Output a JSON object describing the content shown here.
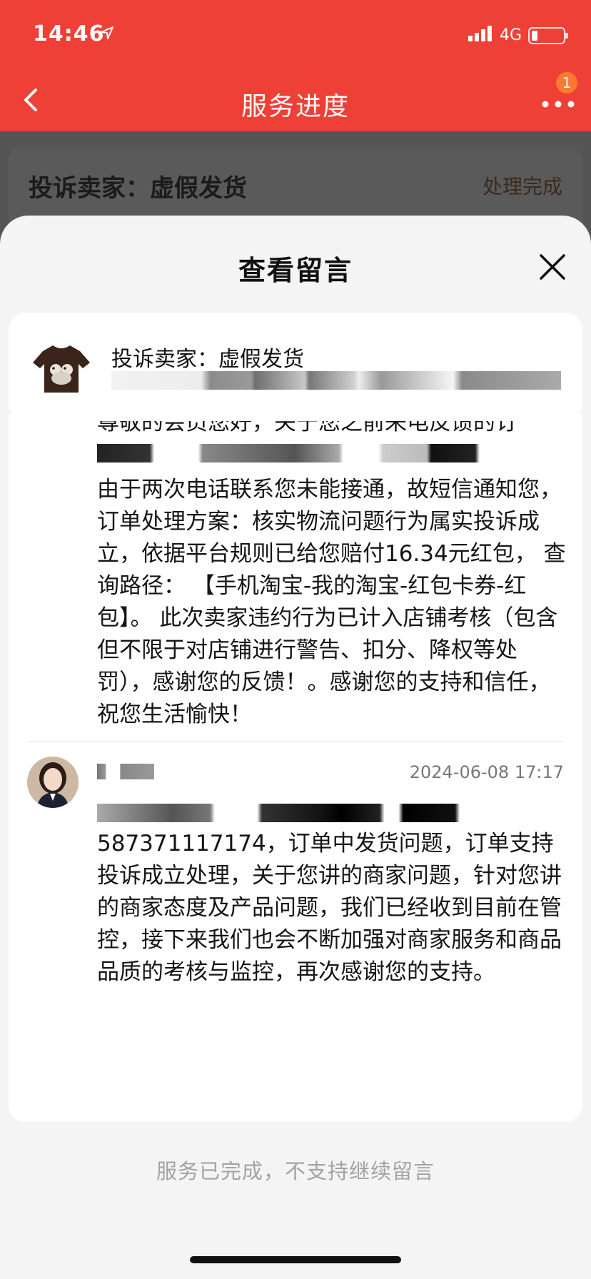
{
  "status_bar": {
    "time": "14:46",
    "network": "4G",
    "battery_level": 0.2
  },
  "nav": {
    "title": "服务进度",
    "badge_count": "1"
  },
  "background": {
    "complaint_title": "投诉卖家：虚假发货",
    "status": "处理完成"
  },
  "sheet": {
    "title": "查看留言",
    "product": {
      "title": "投诉卖家：虚假发货"
    },
    "messages": [
      {
        "partial_first_line": "尊敬的会员您好，关于您之前来电反馈的订",
        "body": "由于两次电话联系您未能接通，故短信通知您，订单处理方案：核实物流问题行为属实投诉成立，依据平台规则已给您赔付16.34元红包， 查询路径： 【手机淘宝-我的淘宝-红包卡券-红包】。 此次卖家违约行为已计入店铺考核（包含但不限于对店铺进行警告、扣分、降权等处罚），感谢您的反馈！。感谢您的支持和信任，祝您生活愉快！"
      },
      {
        "time": "2024-06-08 17:17",
        "body": "587371117174，订单中发货问题，订单支持投诉成立处理，关于您讲的商家问题，针对您讲的商家态度及产品问题，我们已经收到目前在管控，接下来我们也会不断加强对商家服务和商品品质的考核与监控，再次感谢您的支持。"
      }
    ],
    "closed_note": "服务已完成，不支持继续留言"
  },
  "colors": {
    "brand_red": "#ee4036",
    "badge_orange": "#ff7a2e"
  }
}
